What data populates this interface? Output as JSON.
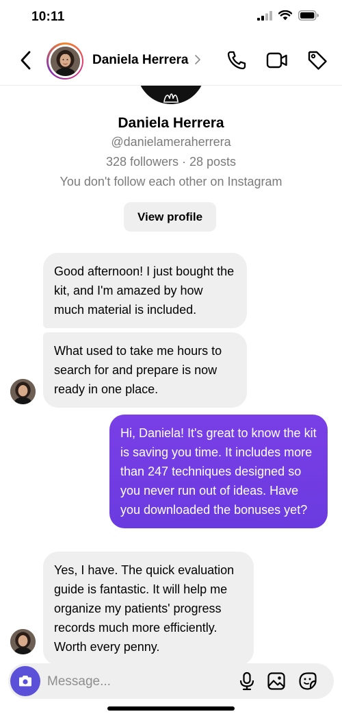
{
  "status_bar": {
    "time": "10:11"
  },
  "header": {
    "name": "Daniela Herrera",
    "chevron": "›"
  },
  "profile": {
    "name": "Daniela Herrera",
    "handle": "@danielameraherrera",
    "stats": "328 followers · 28 posts",
    "note": "You don't follow each other on Instagram",
    "view_profile_label": "View profile"
  },
  "messages": [
    {
      "sender": "them",
      "text": "Good afternoon! I just bought the kit, and I'm amazed by how much material is included."
    },
    {
      "sender": "them",
      "text": "What used to take me hours to search for and prepare is now ready in one place."
    },
    {
      "sender": "me",
      "text": "Hi, Daniela! It's great to know the kit is saving you time. It includes more than 247 techniques designed so you never run out of ideas. Have you downloaded the bonuses yet?"
    },
    {
      "sender": "them",
      "text": "Yes, I have. The quick evaluation guide is fantastic. It will help me organize my patients' progress records much more efficiently. Worth every penny."
    }
  ],
  "composer": {
    "placeholder": "Message..."
  },
  "colors": {
    "outgoing_bubble": "#7a3fe6",
    "incoming_bubble": "#efefef",
    "camera_button": "#5b51d8"
  },
  "icons": [
    "back-arrow-icon",
    "phone-icon",
    "video-icon",
    "tag-icon",
    "camera-icon",
    "microphone-icon",
    "image-icon",
    "sticker-icon"
  ]
}
